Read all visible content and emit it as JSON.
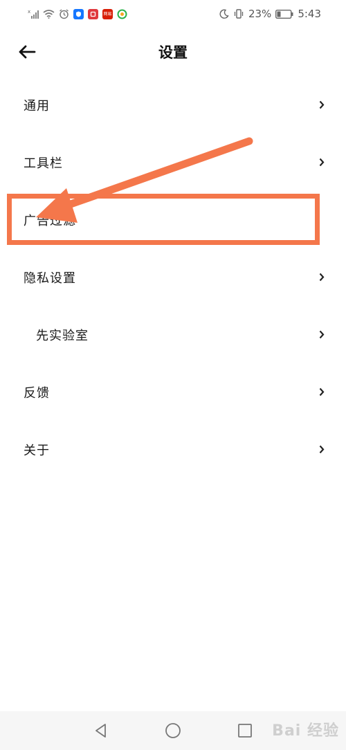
{
  "status_bar": {
    "battery_percent": "23%",
    "time": "5:43",
    "app_badges": [
      {
        "name": "shield-app",
        "color": "#1677ff"
      },
      {
        "name": "red-app",
        "color": "#e0393e"
      },
      {
        "name": "netease-app",
        "color": "#d81e06",
        "text": "网易"
      },
      {
        "name": "circle-app",
        "color": "#2bb24c"
      }
    ]
  },
  "header": {
    "title": "设置"
  },
  "settings": {
    "items": [
      {
        "label": "通用",
        "has_chevron": true
      },
      {
        "label": "工具栏",
        "has_chevron": true
      },
      {
        "label": "广告过滤",
        "has_chevron": false
      },
      {
        "label": "隐私设置",
        "has_chevron": true
      },
      {
        "label": "先实验室",
        "has_chevron": true
      },
      {
        "label": "反馈",
        "has_chevron": true
      },
      {
        "label": "关于",
        "has_chevron": true
      }
    ]
  },
  "annotation": {
    "color": "#f4774b"
  },
  "watermark": {
    "text": "Bai 经验"
  },
  "colors": {
    "background": "#ffffff",
    "text": "#1a1a1a",
    "nav_bar": "#f6f6f6"
  }
}
